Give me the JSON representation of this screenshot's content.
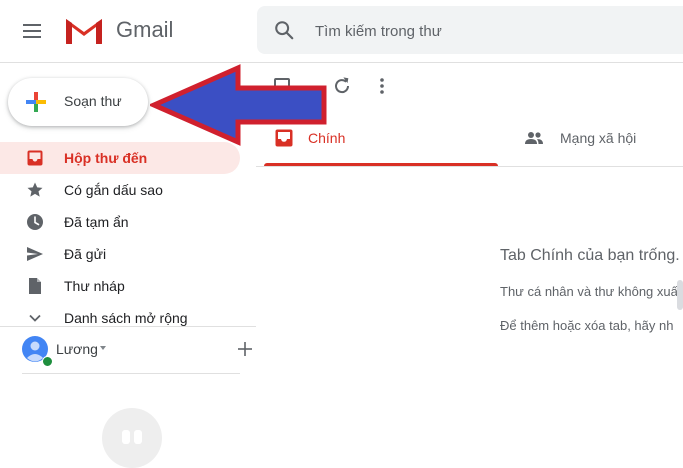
{
  "header": {
    "brand": "Gmail",
    "search_placeholder": "Tìm kiếm trong thư"
  },
  "compose": {
    "label": "Soạn thư"
  },
  "nav": {
    "items": [
      {
        "label": "Hộp thư đến",
        "icon": "inbox-icon",
        "active": true
      },
      {
        "label": "Có gắn dấu sao",
        "icon": "star-icon",
        "active": false
      },
      {
        "label": "Đã tạm ẩn",
        "icon": "clock-icon",
        "active": false
      },
      {
        "label": "Đã gửi",
        "icon": "send-icon",
        "active": false
      },
      {
        "label": "Thư nháp",
        "icon": "draft-icon",
        "active": false
      },
      {
        "label": "Danh sách mở rộng",
        "icon": "chevron-down-icon",
        "active": false
      }
    ]
  },
  "hangouts": {
    "user_name": "Lương"
  },
  "tabs": [
    {
      "label": "Chính",
      "icon": "inbox-icon",
      "selected": true
    },
    {
      "label": "Mạng xã hội",
      "icon": "people-icon",
      "selected": false
    }
  ],
  "empty_state": {
    "title": "Tab Chính của bạn trống.",
    "line1": "Thư cá nhân và thư không xuấ",
    "line2": "Để thêm hoặc xóa tab, hãy nh"
  },
  "colors": {
    "accent_red": "#d93025",
    "active_bg": "#fce8e6",
    "arrow_fill": "#3b4fc4",
    "arrow_stroke": "#d0202e"
  }
}
